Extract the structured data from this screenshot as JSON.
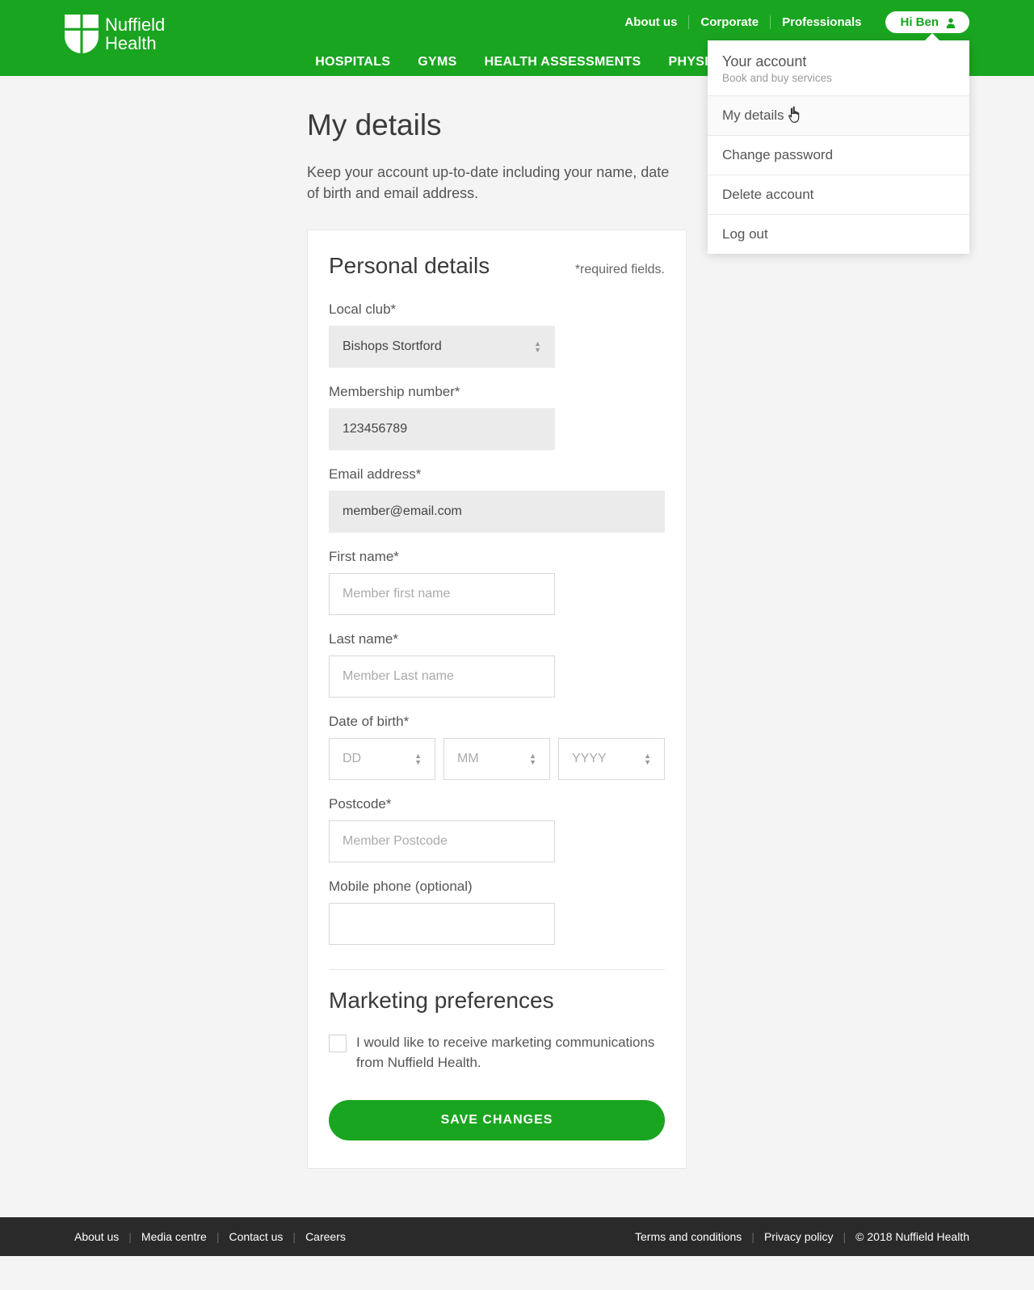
{
  "header": {
    "brand_line1": "Nuffield",
    "brand_line2": "Health",
    "top_links": [
      "About us",
      "Corporate",
      "Professionals"
    ],
    "user_greeting": "Hi Ben",
    "nav": [
      "HOSPITALS",
      "GYMS",
      "HEALTH ASSESSMENTS",
      "PHYSIO"
    ]
  },
  "dropdown": {
    "head_title": "Your account",
    "head_sub": "Book and buy services",
    "items": [
      "My details",
      "Change password",
      "Delete account",
      "Log out"
    ]
  },
  "page": {
    "title": "My details",
    "desc": "Keep your account up-to-date including your name, date of birth and email address."
  },
  "form": {
    "section1_title": "Personal details",
    "required_note": "*required fields.",
    "local_club_label": "Local club*",
    "local_club_value": "Bishops Stortford",
    "membership_label": "Membership number*",
    "membership_value": "123456789",
    "email_label": "Email address*",
    "email_value": "member@email.com",
    "first_name_label": "First name*",
    "first_name_placeholder": "Member first name",
    "last_name_label": "Last name*",
    "last_name_placeholder": "Member Last name",
    "dob_label": "Date of birth*",
    "dob_dd": "DD",
    "dob_mm": "MM",
    "dob_yyyy": "YYYY",
    "postcode_label": "Postcode*",
    "postcode_placeholder": "Member Postcode",
    "mobile_label": "Mobile phone (optional)",
    "section2_title": "Marketing preferences",
    "marketing_checkbox_label": "I would like to receive marketing communications from Nuffield Health.",
    "save_button": "SAVE CHANGES"
  },
  "footer": {
    "left": [
      "About us",
      "Media centre",
      "Contact us",
      "Careers"
    ],
    "right": [
      "Terms and conditions",
      "Privacy policy"
    ],
    "copyright": "© 2018 Nuffield Health"
  }
}
